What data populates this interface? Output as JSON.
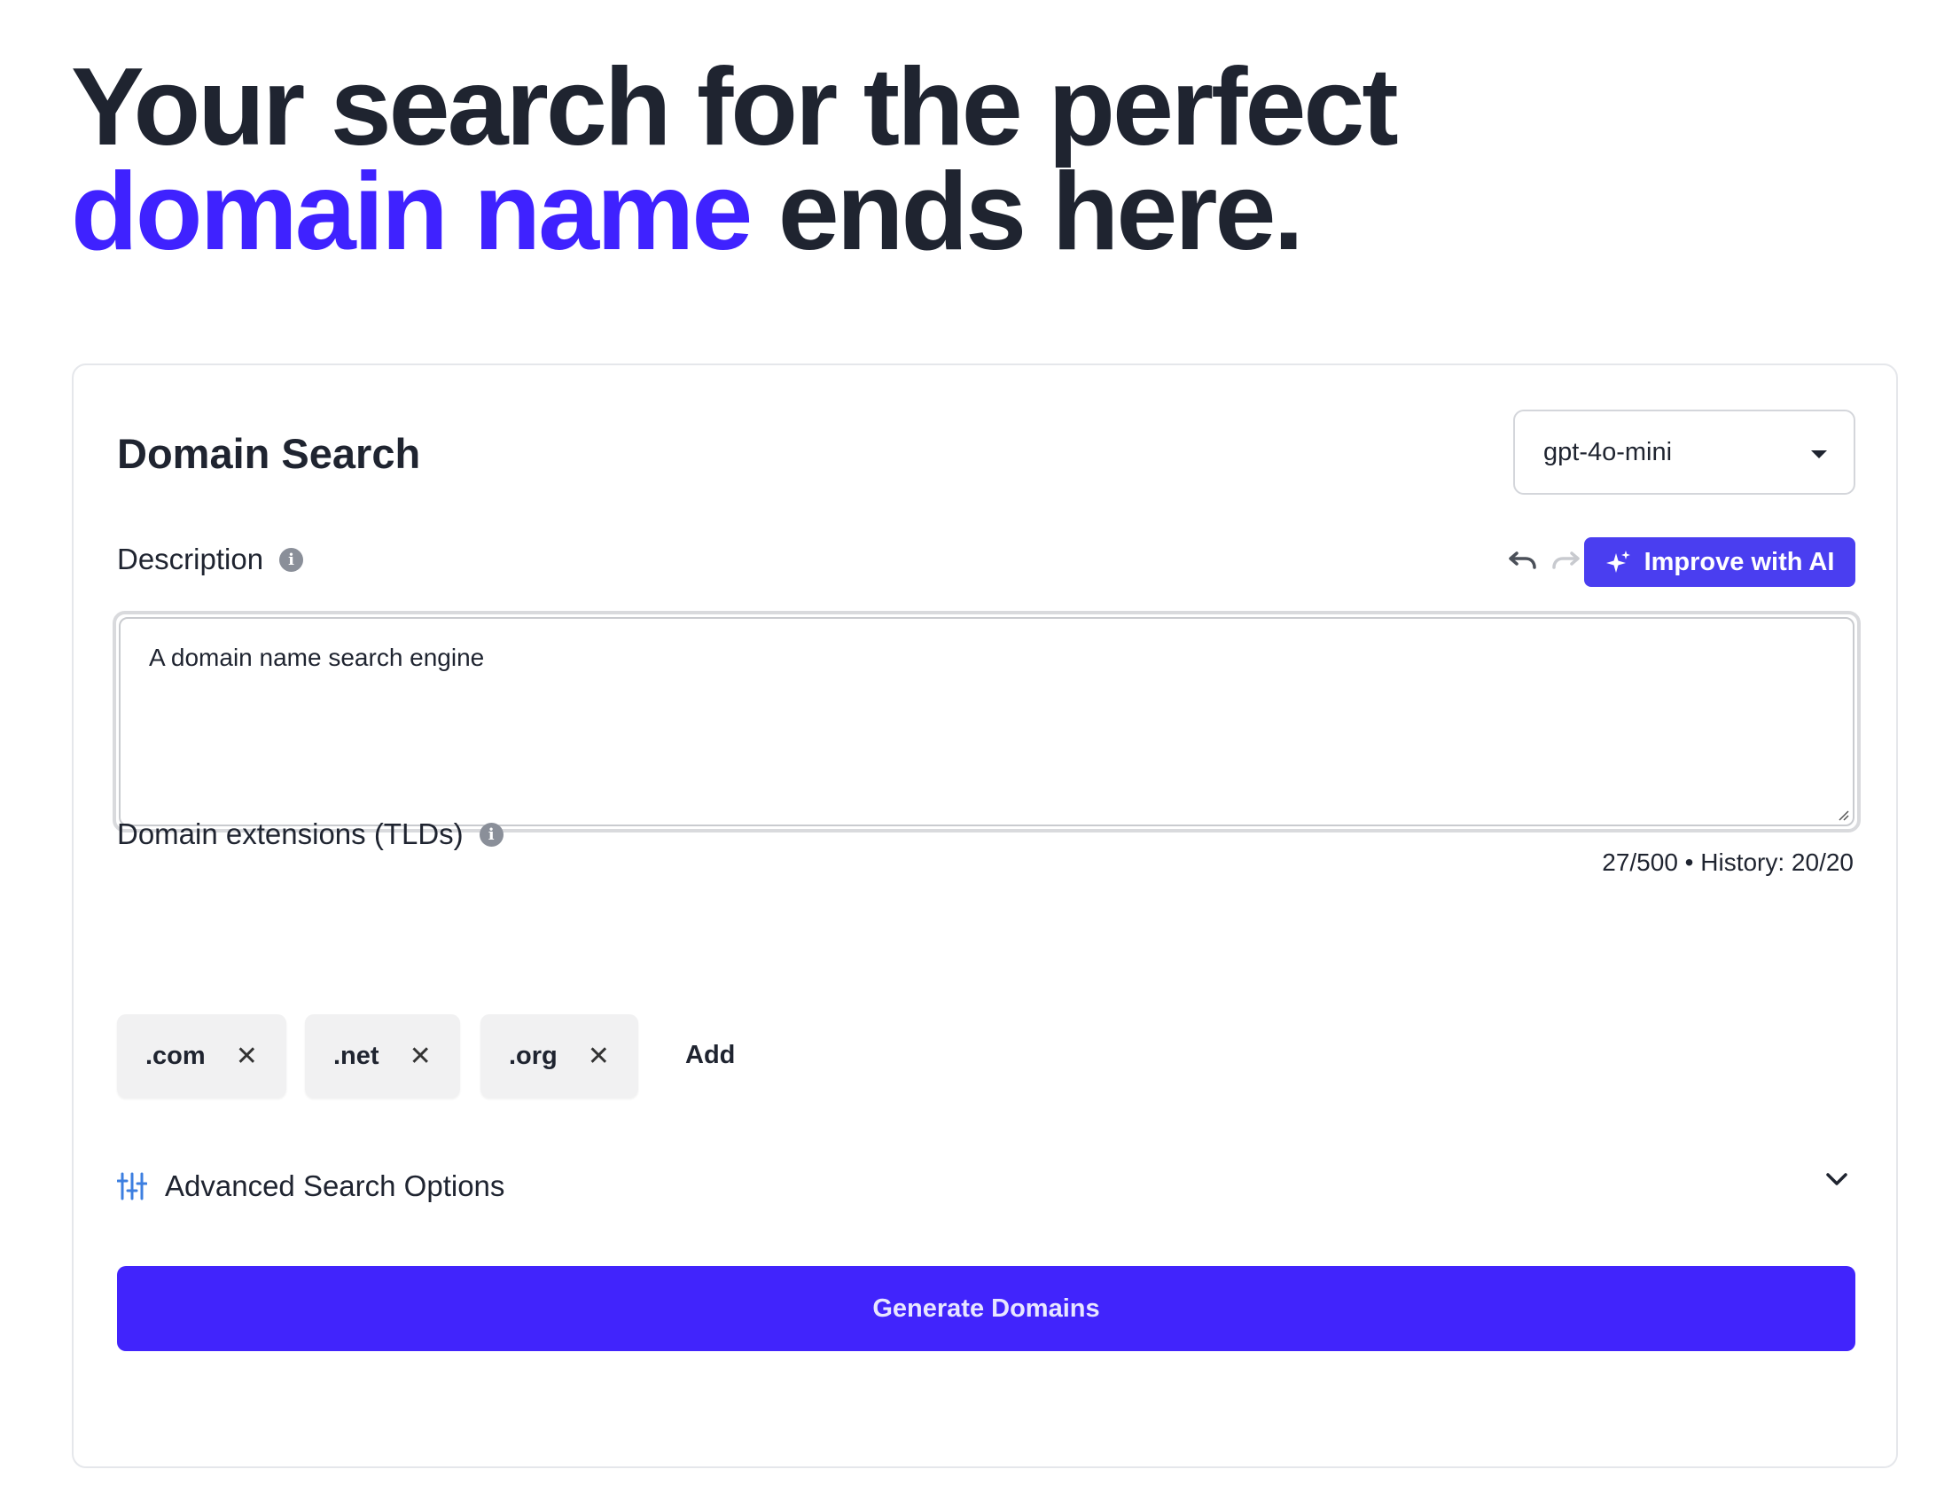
{
  "hero": {
    "line1": "Your search for the perfect",
    "accent": "domain name",
    "rest": " ends here."
  },
  "card": {
    "title": "Domain Search",
    "model": "gpt-4o-mini",
    "description_label": "Description",
    "improve_label": "Improve with AI",
    "description_value": "A domain name search engine",
    "counter": "27/500 • History: 20/20",
    "tld_label": "Domain extensions (TLDs)",
    "tlds": [
      ".com",
      ".net",
      ".org"
    ],
    "add_label": "Add",
    "advanced_label": "Advanced Search Options",
    "generate_label": "Generate Domains"
  },
  "colors": {
    "accent": "#3f22ff",
    "button": "#4124fc",
    "improve": "#4a3ef0",
    "advanced_icon": "#3d7fe0"
  },
  "icons": [
    "info-icon",
    "undo-icon",
    "redo-icon",
    "sparkle-icon",
    "close-icon",
    "sliders-icon",
    "chevron-down-icon",
    "caret-down-icon"
  ]
}
